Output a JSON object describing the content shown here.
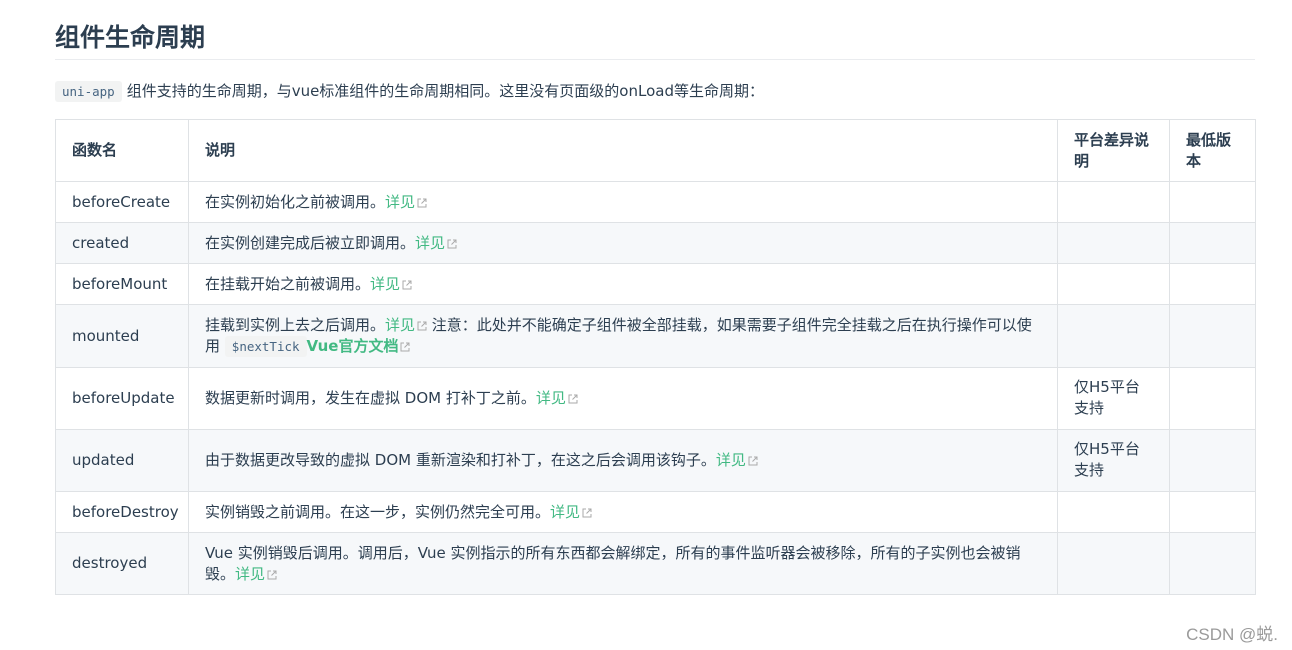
{
  "heading": "组件生命周期",
  "intro": {
    "code": "uni-app",
    "text": "组件支持的生命周期，与vue标准组件的生命周期相同。这里没有页面级的onLoad等生命周期："
  },
  "table": {
    "headers": [
      "函数名",
      "说明",
      "平台差异说明",
      "最低版本"
    ],
    "detail_link": "详见",
    "rows": [
      {
        "name": "beforeCreate",
        "desc": "在实例初始化之前被调用。",
        "platform": "",
        "version": ""
      },
      {
        "name": "created",
        "desc": "在实例创建完成后被立即调用。",
        "platform": "",
        "version": ""
      },
      {
        "name": "beforeMount",
        "desc": "在挂载开始之前被调用。",
        "platform": "",
        "version": ""
      },
      {
        "name": "mounted",
        "desc": "挂载到实例上去之后调用。",
        "desc_note": " 注意：此处并不能确定子组件被全部挂载，如果需要子组件完全挂载之后在执行操作可以使用",
        "desc_code": "$nextTick",
        "desc_doc_link": "Vue官方文档",
        "platform": "",
        "version": ""
      },
      {
        "name": "beforeUpdate",
        "desc": "数据更新时调用，发生在虚拟 DOM 打补丁之前。",
        "platform": "仅H5平台支持",
        "version": ""
      },
      {
        "name": "updated",
        "desc": "由于数据更改导致的虚拟 DOM 重新渲染和打补丁，在这之后会调用该钩子。",
        "platform": "仅H5平台支持",
        "version": ""
      },
      {
        "name": "beforeDestroy",
        "desc": "实例销毁之前调用。在这一步，实例仍然完全可用。",
        "platform": "",
        "version": ""
      },
      {
        "name": "destroyed",
        "desc": "Vue 实例销毁后调用。调用后，Vue 实例指示的所有东西都会解绑定，所有的事件监听器会被移除，所有的子实例也会被销毁。",
        "platform": "",
        "version": ""
      }
    ]
  },
  "watermark": "CSDN @蜕.",
  "colors": {
    "link": "#42b983",
    "text": "#2c3e50",
    "stripe": "#f6f8fa",
    "border": "#dfe2e5"
  },
  "icons": {
    "external_link": "external-link-icon"
  }
}
